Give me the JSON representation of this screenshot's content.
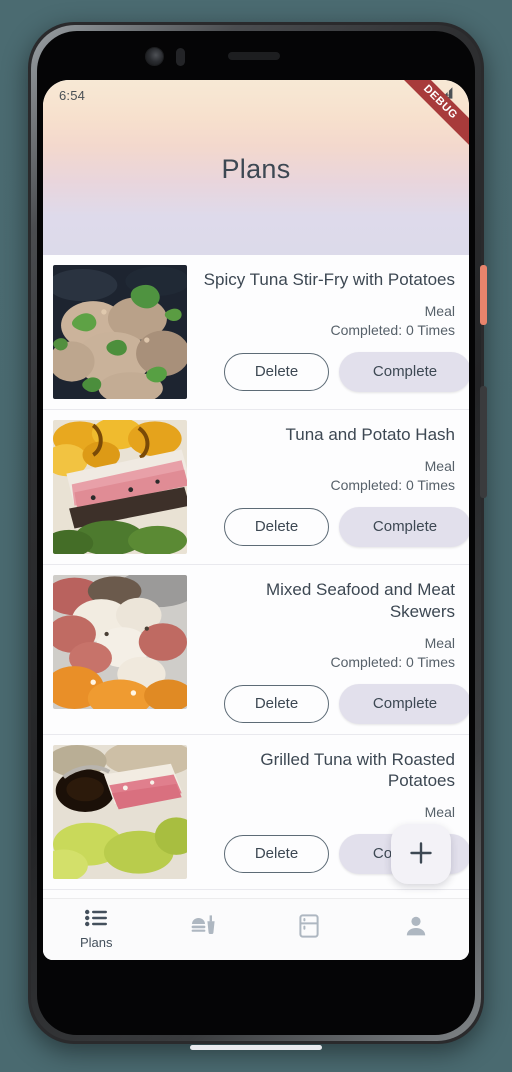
{
  "status_bar": {
    "time": "6:54",
    "icons": [
      "wifi-icon",
      "cellular-no-sim-icon"
    ]
  },
  "debug_banner": {
    "label": "DEBUG",
    "color": "#a83b3b"
  },
  "header": {
    "title": "Plans",
    "gradient_from": "#f7e9d5",
    "gradient_to": "#dcdaea"
  },
  "theme": {
    "accent": "#e2e0ec",
    "text_primary": "#3d4853",
    "text_secondary": "#57616a",
    "surface": "#fdfdfe",
    "phone_backdrop": "#4a6a70",
    "power_button": "#e8846c"
  },
  "plans": [
    {
      "title": "Spicy Tuna Stir-Fry with Potatoes",
      "type": "Meal",
      "completed": "Completed: 0 Times",
      "delete_label": "Delete",
      "complete_label": "Complete",
      "image_name": "spicy-tuna-stir-fry-photo"
    },
    {
      "title": "Tuna and Potato Hash",
      "type": "Meal",
      "completed": "Completed: 0 Times",
      "delete_label": "Delete",
      "complete_label": "Complete",
      "image_name": "tuna-potato-hash-photo"
    },
    {
      "title": "Mixed Seafood and Meat Skewers",
      "type": "Meal",
      "completed": "Completed: 0 Times",
      "delete_label": "Delete",
      "complete_label": "Complete",
      "image_name": "mixed-seafood-meat-skewers-photo"
    },
    {
      "title": "Grilled Tuna with Roasted Potatoes",
      "type": "Meal",
      "completed": "",
      "delete_label": "Delete",
      "complete_label": "Complete",
      "image_name": "grilled-tuna-roasted-potatoes-photo"
    }
  ],
  "fab": {
    "icon": "plus-icon",
    "label": "+"
  },
  "bottom_nav": {
    "items": [
      {
        "label": "Plans",
        "icon": "list-icon",
        "active": true
      },
      {
        "label": "",
        "icon": "fastfood-icon",
        "active": false
      },
      {
        "label": "",
        "icon": "fridge-icon",
        "active": false
      },
      {
        "label": "",
        "icon": "person-icon",
        "active": false
      }
    ]
  }
}
